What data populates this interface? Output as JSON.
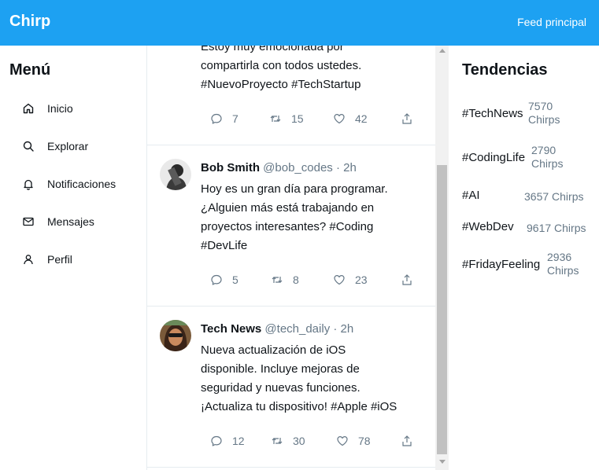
{
  "header": {
    "brand": "Chirp",
    "nav_link": "Feed principal"
  },
  "sidebar": {
    "title": "Menú",
    "items": [
      {
        "label": "Inicio",
        "icon": "home-icon"
      },
      {
        "label": "Explorar",
        "icon": "search-icon"
      },
      {
        "label": "Notificaciones",
        "icon": "bell-icon"
      },
      {
        "label": "Mensajes",
        "icon": "mail-icon"
      },
      {
        "label": "Perfil",
        "icon": "user-icon"
      }
    ]
  },
  "feed": {
    "posts": [
      {
        "name": "",
        "handle": "",
        "time": "",
        "lines": [
          "Estoy muy emocionada por",
          "compartirla con todos ustedes.",
          "#NuevoProyecto #TechStartup"
        ],
        "replies": "7",
        "retweets": "15",
        "likes": "42"
      },
      {
        "name": "Bob Smith",
        "handle": "@bob_codes",
        "time": "· 2h",
        "lines": [
          "Hoy es un gran día para programar.",
          "¿Alguien más está trabajando en",
          "proyectos interesantes? #Coding",
          "#DevLife"
        ],
        "replies": "5",
        "retweets": "8",
        "likes": "23"
      },
      {
        "name": "Tech News",
        "handle": "@tech_daily",
        "time": "· 2h",
        "lines": [
          "Nueva actualización de iOS",
          "disponible. Incluye mejoras de",
          "seguridad y nuevas funciones.",
          "¡Actualiza tu dispositivo! #Apple #iOS"
        ],
        "replies": "12",
        "retweets": "30",
        "likes": "78"
      }
    ]
  },
  "trends": {
    "title": "Tendencias",
    "items": [
      {
        "tag": "#TechNews",
        "count": "7570 Chirps"
      },
      {
        "tag": "#CodingLife",
        "count": "2790 Chirps"
      },
      {
        "tag": "#AI",
        "count": "3657 Chirps"
      },
      {
        "tag": "#WebDev",
        "count": "9617 Chirps"
      },
      {
        "tag": "#FridayFeeling",
        "count": "2936 Chirps"
      }
    ]
  },
  "colors": {
    "brand": "#1da1f2",
    "muted": "#657786",
    "text": "#0f1419"
  }
}
